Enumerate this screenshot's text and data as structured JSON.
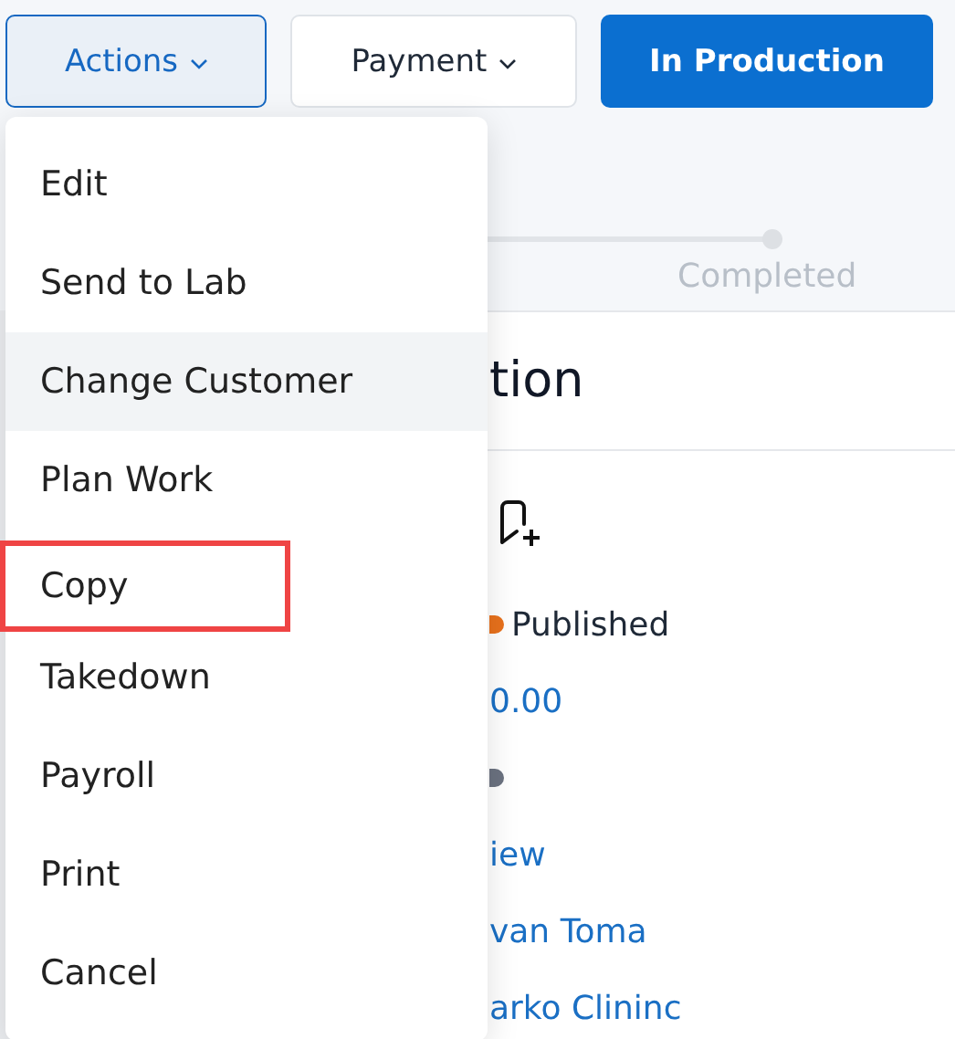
{
  "toolbar": [
    {
      "label": "Actions",
      "kind": "dropdown",
      "open": true
    },
    {
      "label": "Payment",
      "kind": "dropdown",
      "open": false
    },
    {
      "label": "In Production",
      "kind": "primary"
    }
  ],
  "progress": {
    "step_label": "Completed"
  },
  "heading": "tion",
  "details": [
    {
      "kind": "status",
      "text": "Published",
      "color": "#e8711c"
    },
    {
      "kind": "link",
      "text": "0.00"
    },
    {
      "kind": "dot",
      "color": "#6b7280"
    },
    {
      "kind": "link",
      "text": "iew"
    },
    {
      "kind": "link",
      "text": "van Toma"
    },
    {
      "kind": "link",
      "text": "arko Clininc"
    }
  ],
  "menu": [
    {
      "label": "Edit",
      "hovered": false,
      "annotated": false
    },
    {
      "label": "Send to Lab",
      "hovered": false,
      "annotated": false
    },
    {
      "label": "Change Customer",
      "hovered": true,
      "annotated": false
    },
    {
      "label": "Plan Work",
      "hovered": false,
      "annotated": false
    },
    {
      "label": "Copy",
      "hovered": false,
      "annotated": true
    },
    {
      "label": "Takedown",
      "hovered": false,
      "annotated": false
    },
    {
      "label": "Payroll",
      "hovered": false,
      "annotated": false
    },
    {
      "label": "Print",
      "hovered": false,
      "annotated": false
    },
    {
      "label": "Cancel",
      "hovered": false,
      "annotated": false
    }
  ]
}
